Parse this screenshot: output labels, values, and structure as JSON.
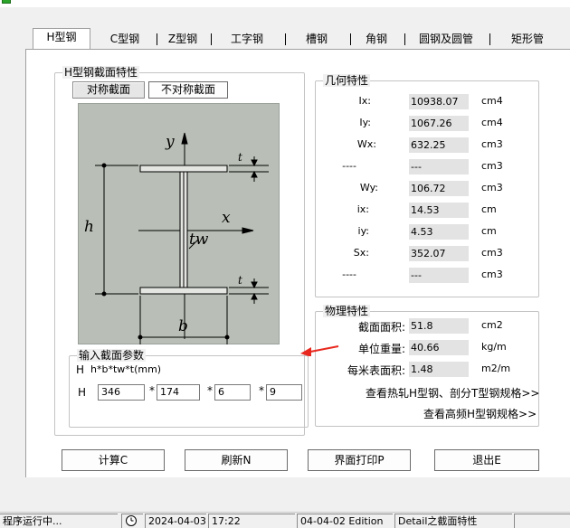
{
  "tabs": [
    {
      "label": "H型钢",
      "active": true
    },
    {
      "label": "C型钢"
    },
    {
      "label": "Z型钢"
    },
    {
      "label": "工字钢"
    },
    {
      "label": "槽钢"
    },
    {
      "label": "角钢"
    },
    {
      "label": "圆钢及圆管"
    },
    {
      "label": "矩形管"
    }
  ],
  "section_group": {
    "title": "H型钢截面特性",
    "symmetric_btn": "对称截面",
    "asymmetric_btn": "不对称截面"
  },
  "diagram_labels": {
    "y": "y",
    "x": "x",
    "h": "h",
    "b": "b",
    "tw": "tw",
    "t_top": "t",
    "t_bottom": "t"
  },
  "geometry": {
    "title": "几何特性",
    "rows": [
      {
        "label": "Ix:",
        "value": "10938.07",
        "unit": "cm4"
      },
      {
        "label": "Iy:",
        "value": "1067.26",
        "unit": "cm4"
      },
      {
        "label": "Wx:",
        "value": "632.25",
        "unit": "cm3"
      },
      {
        "label": "----",
        "value": "---",
        "unit": "cm3"
      },
      {
        "label": "Wy:",
        "value": "106.72",
        "unit": "cm3"
      },
      {
        "label": "ix:",
        "value": "14.53",
        "unit": "cm"
      },
      {
        "label": "iy:",
        "value": "4.53",
        "unit": "cm"
      },
      {
        "label": "Sx:",
        "value": "352.07",
        "unit": "cm3"
      },
      {
        "label": "----",
        "value": "---",
        "unit": "cm3"
      }
    ]
  },
  "physical": {
    "title": "物理特性",
    "rows": [
      {
        "label": "截面面积:",
        "value": "51.8",
        "unit": "cm2"
      },
      {
        "label": "单位重量:",
        "value": "40.66",
        "unit": "kg/m"
      },
      {
        "label": "每米表面积:",
        "value": "1.48",
        "unit": "m2/m"
      }
    ],
    "link1": "查看热轧H型钢、剖分T型钢规格>>",
    "link2": "查看高频H型钢规格>>"
  },
  "input_group": {
    "title": "输入截面参数",
    "formula_label": "H",
    "formula": "h*b*tw*t(mm)",
    "row_label": "H",
    "values": [
      "346",
      "174",
      "6",
      "9"
    ],
    "sep": "*"
  },
  "buttons": {
    "calc": "计算C",
    "refresh": "刷新N",
    "print": "界面打印P",
    "exit": "退出E"
  },
  "status": {
    "running": "程序运行中...",
    "date": "2024-04-03",
    "time": "17:22",
    "edition": "04-04-02 Edition",
    "module": "Detail之截面特性"
  },
  "colors": {
    "arrow": "#e8281e",
    "diagram_bg": "#b9bfb6"
  }
}
